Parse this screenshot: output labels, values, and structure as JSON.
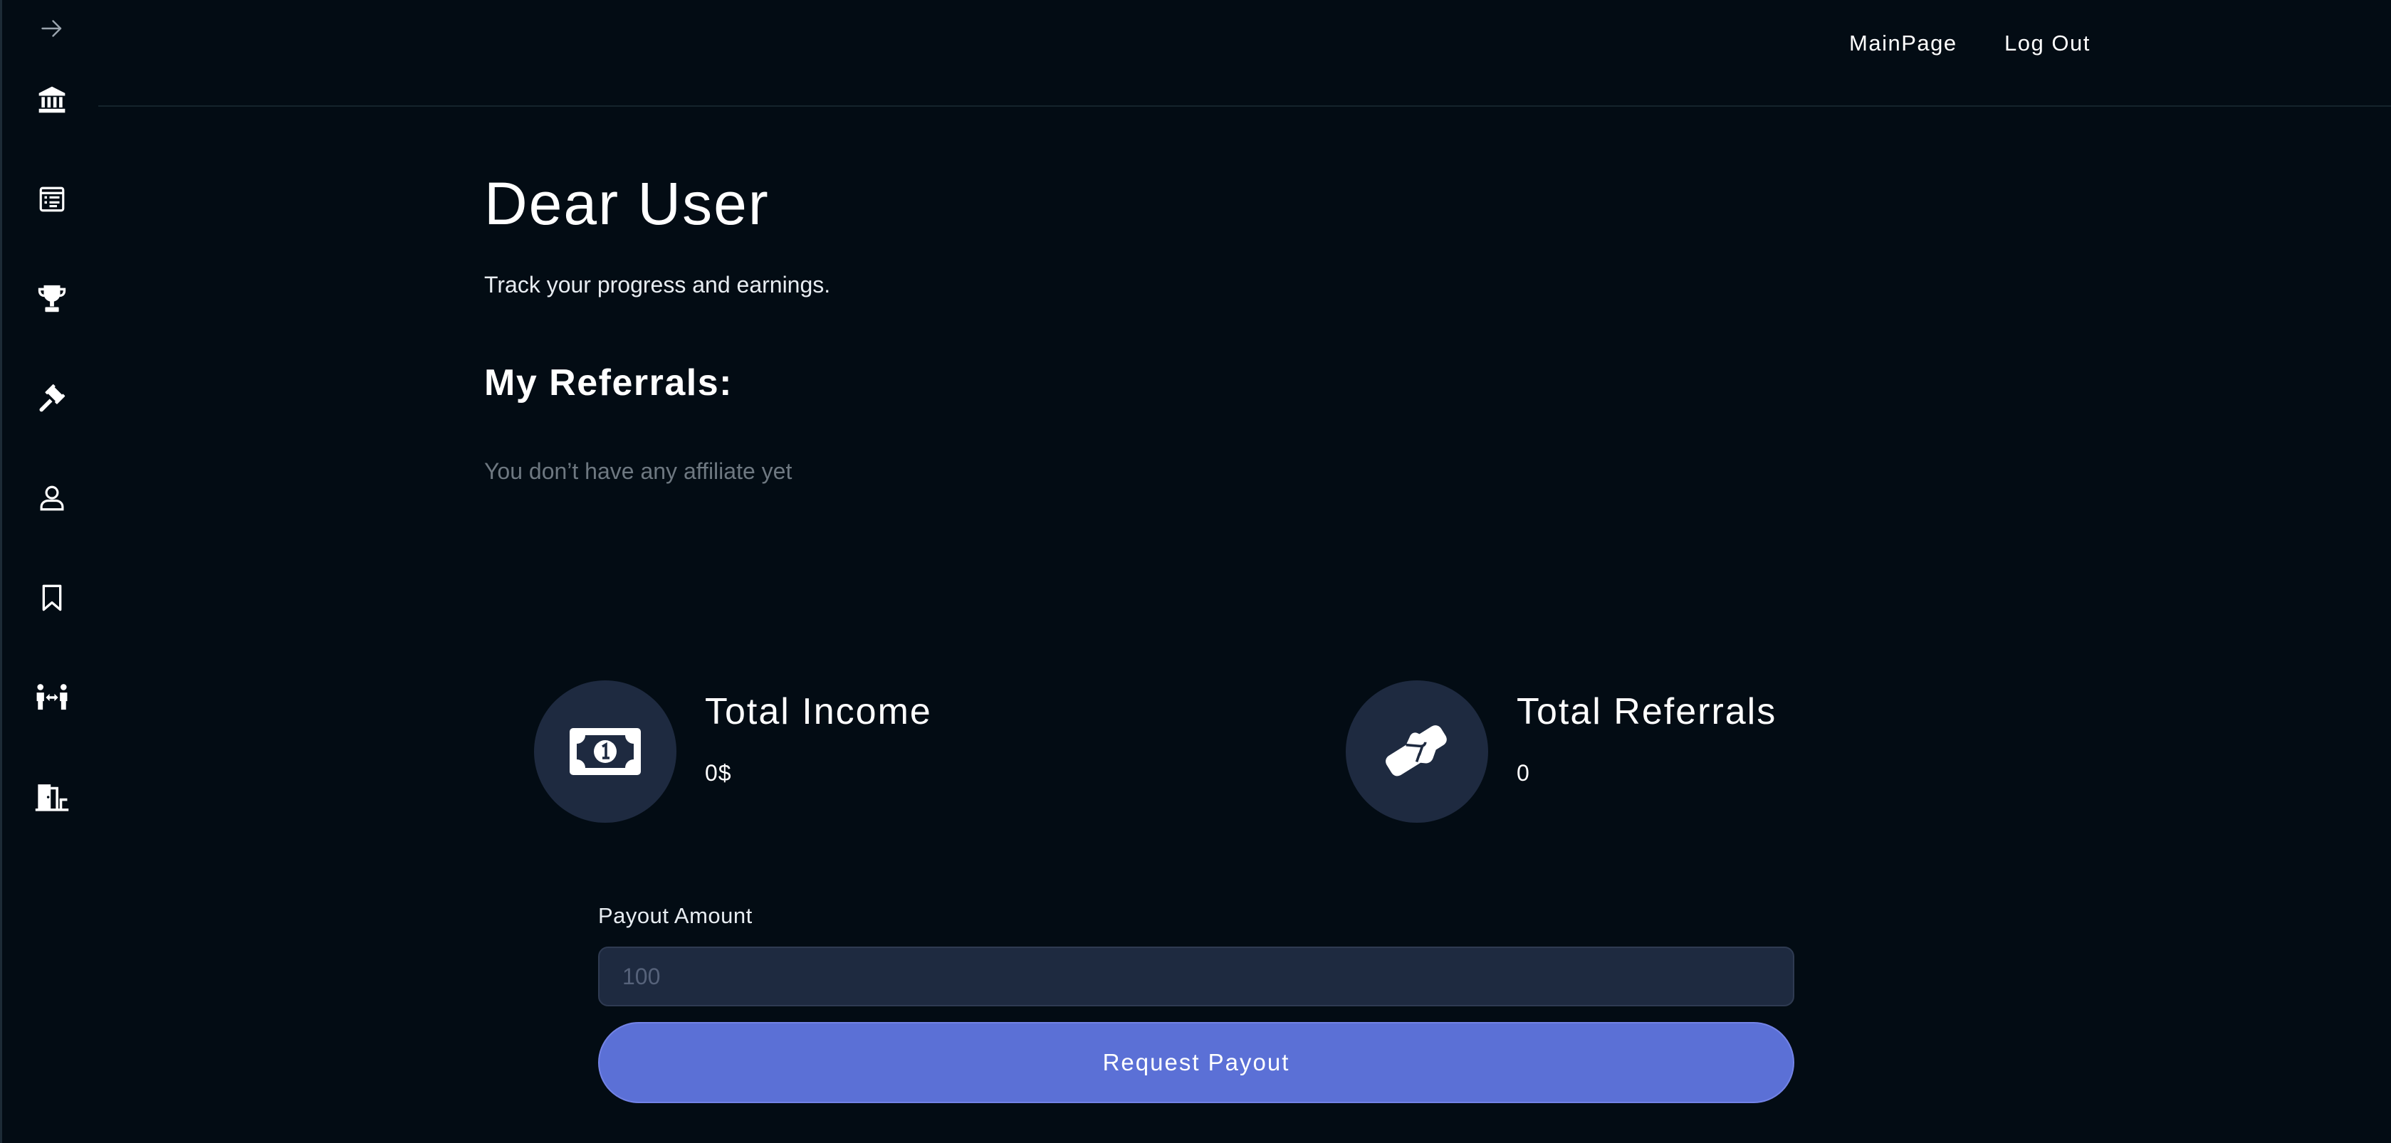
{
  "sidebar": {
    "items": [
      {
        "icon": "arrow-right-icon"
      },
      {
        "icon": "bank-icon"
      },
      {
        "icon": "list-icon"
      },
      {
        "icon": "trophy-icon"
      },
      {
        "icon": "gavel-icon"
      },
      {
        "icon": "user-icon"
      },
      {
        "icon": "bookmark-icon"
      },
      {
        "icon": "people-exchange-icon"
      },
      {
        "icon": "door-exit-icon"
      }
    ]
  },
  "header": {
    "nav": [
      {
        "label": "MainPage"
      },
      {
        "label": "Log Out"
      }
    ]
  },
  "main": {
    "title": "Dear User",
    "subtitle": "Track your progress and earnings.",
    "referrals_heading": "My Referrals:",
    "referrals_empty": "You don’t have any affiliate yet"
  },
  "stats": [
    {
      "title": "Total Income",
      "value": "0$",
      "icon": "money-bill-icon"
    },
    {
      "title": "Total Referrals",
      "value": "0",
      "icon": "handshake-icon"
    }
  ],
  "payout": {
    "label": "Payout Amount",
    "placeholder": "100",
    "value": "",
    "button_label": "Request Payout"
  },
  "colors": {
    "background": "#030c14",
    "card": "#1e2a40",
    "accent": "#5b70d6",
    "muted_text": "#6e7881"
  }
}
